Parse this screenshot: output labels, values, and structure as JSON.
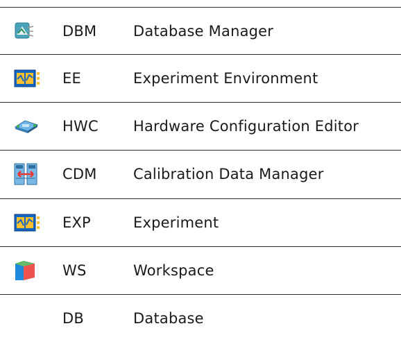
{
  "rows": [
    {
      "icon": "database-manager-icon",
      "abbr": "DBM",
      "name": "Database Manager"
    },
    {
      "icon": "experiment-environment-icon",
      "abbr": "EE",
      "name": "Experiment Environment"
    },
    {
      "icon": "hardware-configuration-icon",
      "abbr": "HWC",
      "name": "Hardware Configuration Editor"
    },
    {
      "icon": "calibration-data-manager-icon",
      "abbr": "CDM",
      "name": "Calibration Data Manager"
    },
    {
      "icon": "experiment-icon",
      "abbr": "EXP",
      "name": "Experiment"
    },
    {
      "icon": "workspace-icon",
      "abbr": "WS",
      "name": "Workspace"
    },
    {
      "icon": "",
      "abbr": "DB",
      "name": "Database"
    }
  ]
}
